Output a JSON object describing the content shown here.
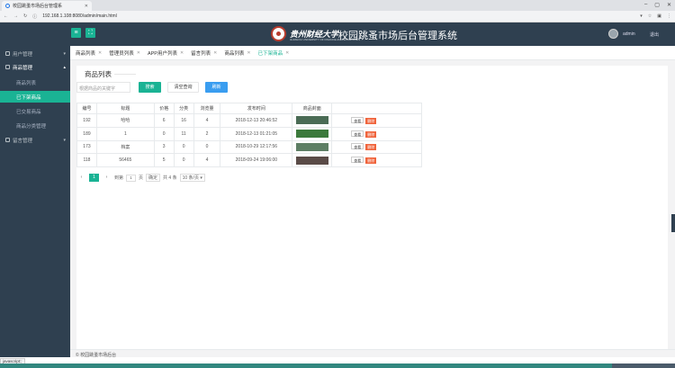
{
  "browser": {
    "tab_title": "校园跳蚤市场后台管理系",
    "url": "192.168.1.108:8080/admin/main.html",
    "min": "–",
    "max": "▢",
    "close": "✕",
    "tab_close": "✕"
  },
  "header": {
    "brand": "贵州财经大学",
    "brand_sub": "GUIZHOU UNIVERSITY OF FINANCE AND ECONOMICS",
    "system_title": "校园跳蚤市场后台管理系统",
    "username": "admin",
    "logout": "退出"
  },
  "sidebar": {
    "user_mgmt": "用户管理",
    "goods_mgmt": "商品管理",
    "goods_children": [
      "商品列表",
      "已下架商品",
      "已交易商品",
      "商品分类管理"
    ],
    "message_mgmt": "留言管理"
  },
  "tabs": [
    {
      "label": "商品列表",
      "active": false
    },
    {
      "label": "管理员列表",
      "active": false
    },
    {
      "label": "APP用户列表",
      "active": false
    },
    {
      "label": "留言列表",
      "active": false
    },
    {
      "label": "商品列表",
      "active": false
    },
    {
      "label": "已下架商品",
      "active": true
    }
  ],
  "panel": {
    "title": "商品列表",
    "search_placeholder": "根据商品的关键字",
    "btn_search": "搜索",
    "btn_clear": "清空查询",
    "btn_refresh": "刷新"
  },
  "table": {
    "headers": [
      "编号",
      "标题",
      "价格",
      "分类",
      "浏览量",
      "发布时间",
      "商品封面",
      ""
    ],
    "rows": [
      {
        "id": "192",
        "title": "哈哈",
        "price": "6",
        "cat": "16",
        "views": "4",
        "time": "2018-12-13 20:46:52",
        "thumb_color": "#4a6b55",
        "view": "查看",
        "del": "删除"
      },
      {
        "id": "189",
        "title": "1",
        "price": "0",
        "cat": "11",
        "views": "2",
        "time": "2018-12-13 01:21:05",
        "thumb_color": "#3c7a3c",
        "view": "查看",
        "del": "删除"
      },
      {
        "id": "173",
        "title": "档案",
        "price": "3",
        "cat": "0",
        "views": "0",
        "time": "2018-10-29 12:17:56",
        "thumb_color": "#5d7e64",
        "view": "查看",
        "del": "删除"
      },
      {
        "id": "118",
        "title": "56465",
        "price": "5",
        "cat": "0",
        "views": "4",
        "time": "2018-09-24 19:06:00",
        "thumb_color": "#5a4b47",
        "view": "查看",
        "del": "删除"
      }
    ]
  },
  "pager": {
    "prev": "‹",
    "page": "1",
    "next": "›",
    "to": "到第",
    "page_val": "1",
    "page_unit": "页",
    "confirm": "确定",
    "total": "共 4 条",
    "per_page": "10 条/页 ▾"
  },
  "footer": {
    "text": "© 校园跳蚤市场后台"
  },
  "status": {
    "url": "javascript:;"
  }
}
